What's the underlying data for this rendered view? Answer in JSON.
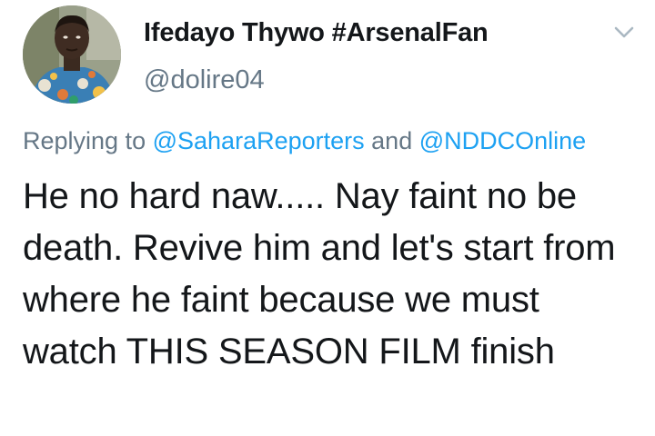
{
  "author": {
    "display_name": "Ifedayo Thywo #ArsenalFan",
    "handle": "@dolire04"
  },
  "reply": {
    "prefix": "Replying to",
    "mention_1": "@SaharaReporters",
    "joiner": "and",
    "mention_2": "@NDDCOnline"
  },
  "tweet": {
    "text": "He no hard naw..... Nay faint no be death. Revive him and let's start from where he faint because we must watch THIS SEASON FILM finish"
  },
  "icons": {
    "menu": "chevron-down-icon",
    "avatar": "profile-photo"
  },
  "colors": {
    "name": "#14171a",
    "secondary": "#657786",
    "link": "#1da1f2"
  }
}
